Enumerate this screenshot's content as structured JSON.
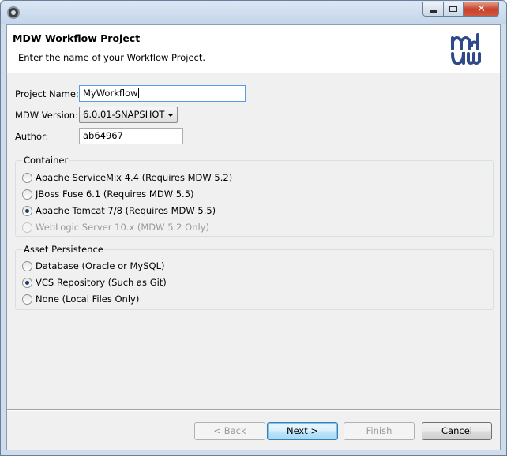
{
  "window": {
    "title": "",
    "controls": {
      "minimize": "minimize",
      "maximize": "maximize",
      "close": "✕"
    }
  },
  "banner": {
    "title": "MDW Workflow Project",
    "message": "Enter the name of your Workflow Project.",
    "logo_icon": "mdw-logo"
  },
  "form": {
    "project_name_label": "Project Name:",
    "project_name_value": "MyWorkflow",
    "mdw_version_label": "MDW Version:",
    "mdw_version_value": "6.0.01-SNAPSHOT",
    "author_label": "Author:",
    "author_value": "ab64967"
  },
  "container": {
    "title": "Container",
    "options": [
      {
        "label": "Apache ServiceMix 4.4 (Requires MDW 5.2)",
        "checked": false,
        "disabled": false
      },
      {
        "label": "JBoss Fuse 6.1 (Requires MDW 5.5)",
        "checked": false,
        "disabled": false
      },
      {
        "label": "Apache Tomcat 7/8 (Requires MDW 5.5)",
        "checked": true,
        "disabled": false
      },
      {
        "label": "WebLogic Server 10.x (MDW 5.2 Only)",
        "checked": false,
        "disabled": true
      }
    ]
  },
  "asset_persistence": {
    "title": "Asset Persistence",
    "options": [
      {
        "label": "Database (Oracle or MySQL)",
        "checked": false
      },
      {
        "label": "VCS Repository (Such as Git)",
        "checked": true
      },
      {
        "label": "None (Local Files Only)",
        "checked": false
      }
    ]
  },
  "buttons": {
    "back": {
      "prefix": "< ",
      "mnemonic": "B",
      "rest": "ack"
    },
    "next": {
      "mnemonic": "N",
      "rest": "ext >"
    },
    "finish": {
      "mnemonic": "F",
      "rest": "inish"
    },
    "cancel": "Cancel"
  },
  "colors": {
    "accent": "#3c7fb1",
    "logo": "#2f4a8a"
  }
}
